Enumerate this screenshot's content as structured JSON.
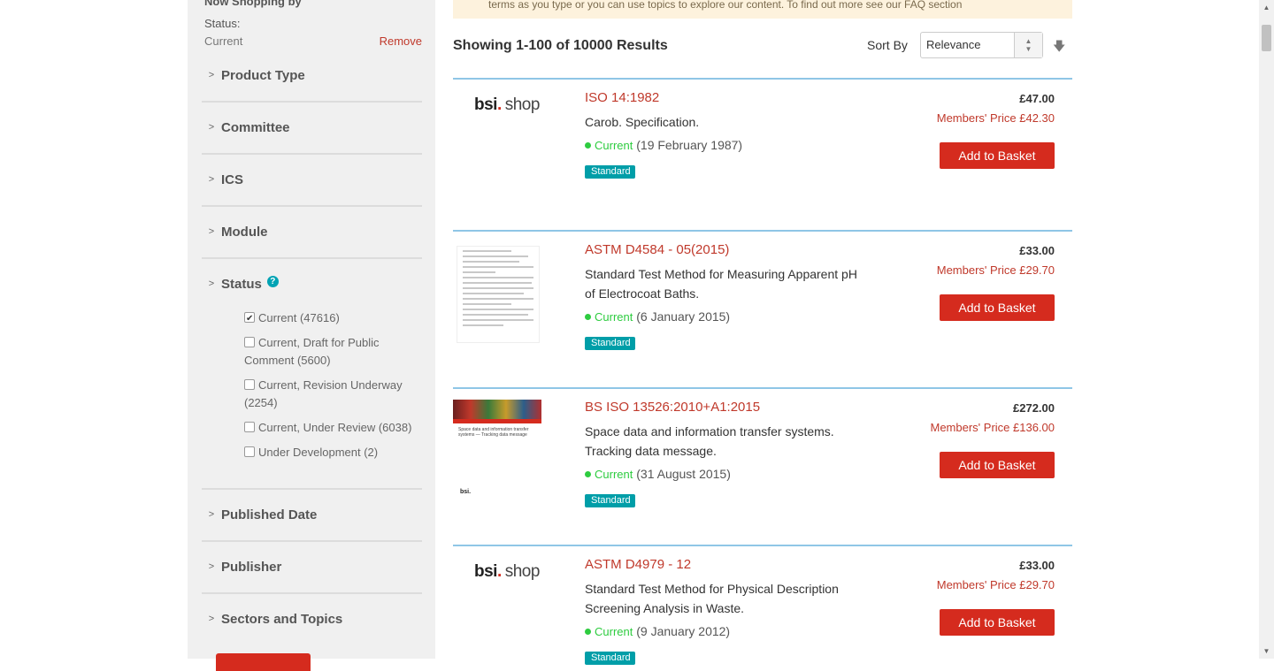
{
  "sidebar": {
    "shop_by_title": "Now Shopping by",
    "current_filter_label": "Status:",
    "current_filter_value": "Current",
    "remove_label": "Remove",
    "facets": [
      {
        "label": "Product Type"
      },
      {
        "label": "Committee"
      },
      {
        "label": "ICS"
      },
      {
        "label": "Module"
      },
      {
        "label": "Status"
      },
      {
        "label": "Published Date"
      },
      {
        "label": "Publisher"
      },
      {
        "label": "Sectors and Topics"
      }
    ],
    "status_options": [
      {
        "label": "Current (47616)",
        "checked": true
      },
      {
        "label": "Current, Draft for Public Comment (5600)",
        "checked": false
      },
      {
        "label": "Current, Revision Underway (2254)",
        "checked": false
      },
      {
        "label": "Current, Under Review (6038)",
        "checked": false
      },
      {
        "label": "Under Development (2)",
        "checked": false
      }
    ]
  },
  "notice": "terms as you type or you can use topics to explore our content. To find out more see our FAQ section",
  "results_header": {
    "count_text": "Showing 1-100 of 10000 Results",
    "sort_label": "Sort By",
    "sort_value": "Relevance"
  },
  "logo": {
    "bsi": "bsi",
    "dot": ".",
    "shop": "shop"
  },
  "results": [
    {
      "code": "ISO 14:1982",
      "title": "Carob. Specification.",
      "status": "Current",
      "date": "(19 February 1987)",
      "badge": "Standard",
      "price": "£47.00",
      "member_price": "Members' Price £42.30",
      "button": "Add to Basket",
      "thumb": "bsi-shop-logo"
    },
    {
      "code": "ASTM D4584 - 05(2015)",
      "title": "Standard Test Method for Measuring Apparent pH of Electrocoat Baths.",
      "status": "Current",
      "date": "(6 January 2015)",
      "badge": "Standard",
      "price": "£33.00",
      "member_price": "Members' Price £29.70",
      "button": "Add to Basket",
      "thumb": "document-preview"
    },
    {
      "code": "BS ISO 13526:2010+A1:2015",
      "title": "Space data and information transfer systems. Tracking data message.",
      "status": "Current",
      "date": "(31 August 2015)",
      "badge": "Standard",
      "price": "£272.00",
      "member_price": "Members' Price £136.00",
      "button": "Add to Basket",
      "thumb": "bsi-cover"
    },
    {
      "code": "ASTM D4979 - 12",
      "title": "Standard Test Method for Physical Description Screening Analysis in Waste.",
      "status": "Current",
      "date": "(9 January 2012)",
      "badge": "Standard",
      "price": "£33.00",
      "member_price": "Members' Price £29.70",
      "button": "Add to Basket",
      "thumb": "bsi-shop-logo"
    }
  ],
  "cover_thumb": {
    "title": "Space data and information transfer systems — Tracking data message",
    "logo": "bsi."
  },
  "colors": {
    "accent_red": "#d52b1e",
    "badge_teal": "#009ea8",
    "divider_blue": "#8fc6e6",
    "status_green": "#2ecc40"
  }
}
